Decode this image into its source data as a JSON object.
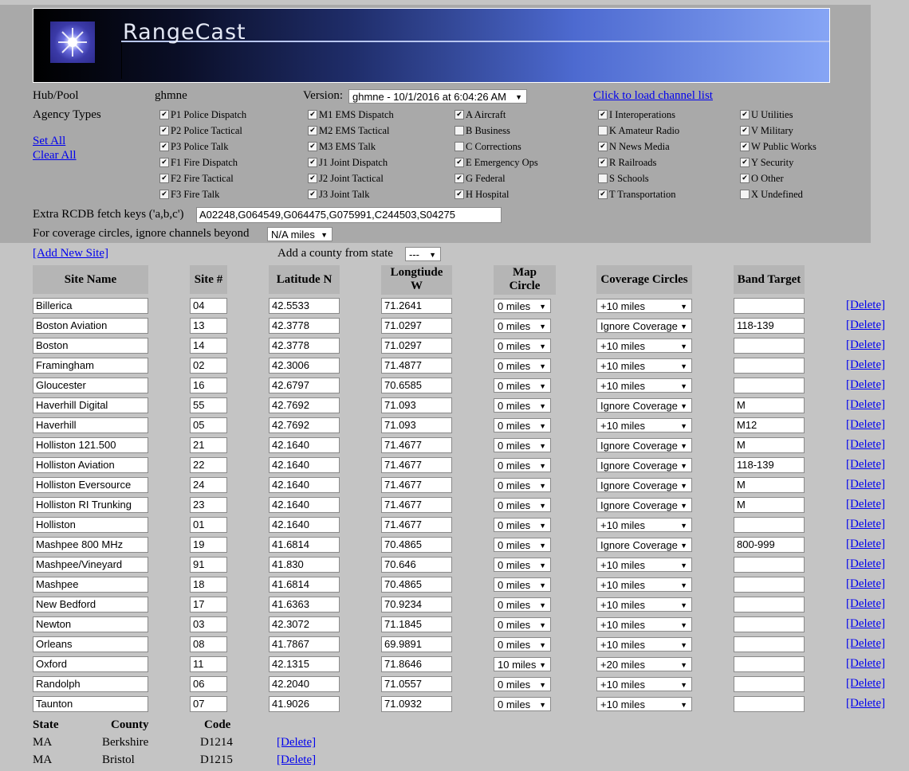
{
  "banner": {
    "title": "RangeCast"
  },
  "hub": {
    "label": "Hub/Pool",
    "value": "ghmne"
  },
  "version": {
    "label": "Version:",
    "value": "ghmne - 10/1/2016 at 6:04:26 AM"
  },
  "load_channels": "Click to load channel list",
  "agency": {
    "label": "Agency Types",
    "set_all": "Set All",
    "clear_all": "Clear All",
    "columns": [
      [
        {
          "label": "P1 Police Dispatch",
          "checked": true
        },
        {
          "label": "P2 Police Tactical",
          "checked": true
        },
        {
          "label": "P3 Police Talk",
          "checked": true
        },
        {
          "label": "F1 Fire Dispatch",
          "checked": true
        },
        {
          "label": "F2 Fire Tactical",
          "checked": true
        },
        {
          "label": "F3 Fire Talk",
          "checked": true
        }
      ],
      [
        {
          "label": "M1 EMS Dispatch",
          "checked": true
        },
        {
          "label": "M2 EMS Tactical",
          "checked": true
        },
        {
          "label": "M3 EMS Talk",
          "checked": true
        },
        {
          "label": "J1 Joint Dispatch",
          "checked": true
        },
        {
          "label": "J2 Joint Tactical",
          "checked": true
        },
        {
          "label": "J3 Joint Talk",
          "checked": true
        }
      ],
      [
        {
          "label": "A Aircraft",
          "checked": true
        },
        {
          "label": "B Business",
          "checked": false
        },
        {
          "label": "C Corrections",
          "checked": false
        },
        {
          "label": "E Emergency Ops",
          "checked": true
        },
        {
          "label": "G Federal",
          "checked": true
        },
        {
          "label": "H Hospital",
          "checked": true
        }
      ],
      [
        {
          "label": "I Interoperations",
          "checked": true
        },
        {
          "label": "K Amateur Radio",
          "checked": false
        },
        {
          "label": "N News Media",
          "checked": true
        },
        {
          "label": "R Railroads",
          "checked": true
        },
        {
          "label": "S Schools",
          "checked": false
        },
        {
          "label": "T Transportation",
          "checked": true
        }
      ],
      [
        {
          "label": "U Utilities",
          "checked": true
        },
        {
          "label": "V Military",
          "checked": true
        },
        {
          "label": "W Public Works",
          "checked": true
        },
        {
          "label": "Y Security",
          "checked": true
        },
        {
          "label": "O Other",
          "checked": true
        },
        {
          "label": "X Undefined",
          "checked": false
        }
      ]
    ]
  },
  "extra_keys": {
    "label": "Extra RCDB fetch keys ('a,b,c')",
    "value": "A02248,G064549,G064475,G075991,C244503,S04275"
  },
  "coverage_ignore": {
    "label": "For coverage circles, ignore channels beyond",
    "value": "N/A miles"
  },
  "add_site": "[Add New Site]",
  "add_county": {
    "label": "Add a county from state",
    "value": "---"
  },
  "table": {
    "headers": {
      "name": "Site Name",
      "num": "Site #",
      "lat": "Latitude N",
      "lon1": "Longtiude",
      "lon2": "W",
      "map1": "Map",
      "map2": "Circle",
      "cov": "Coverage Circles",
      "band": "Band Target"
    },
    "delete_label": "[Delete]",
    "rows": [
      {
        "name": "Billerica",
        "num": "04",
        "lat": "42.5533",
        "lon": "71.2641",
        "map": "0 miles",
        "cov": "+10 miles",
        "band": ""
      },
      {
        "name": "Boston Aviation",
        "num": "13",
        "lat": "42.3778",
        "lon": "71.0297",
        "map": "0 miles",
        "cov": "Ignore Coverage",
        "band": "118-139"
      },
      {
        "name": "Boston",
        "num": "14",
        "lat": "42.3778",
        "lon": "71.0297",
        "map": "0 miles",
        "cov": "+10 miles",
        "band": ""
      },
      {
        "name": "Framingham",
        "num": "02",
        "lat": "42.3006",
        "lon": "71.4877",
        "map": "0 miles",
        "cov": "+10 miles",
        "band": ""
      },
      {
        "name": "Gloucester",
        "num": "16",
        "lat": "42.6797",
        "lon": "70.6585",
        "map": "0 miles",
        "cov": "+10 miles",
        "band": ""
      },
      {
        "name": "Haverhill Digital",
        "num": "55",
        "lat": "42.7692",
        "lon": "71.093",
        "map": "0 miles",
        "cov": "Ignore Coverage",
        "band": "M"
      },
      {
        "name": "Haverhill",
        "num": "05",
        "lat": "42.7692",
        "lon": "71.093",
        "map": "0 miles",
        "cov": "+10 miles",
        "band": "M12"
      },
      {
        "name": "Holliston 121.500",
        "num": "21",
        "lat": "42.1640",
        "lon": "71.4677",
        "map": "0 miles",
        "cov": "Ignore Coverage",
        "band": "M"
      },
      {
        "name": "Holliston Aviation",
        "num": "22",
        "lat": "42.1640",
        "lon": "71.4677",
        "map": "0 miles",
        "cov": "Ignore Coverage",
        "band": "118-139"
      },
      {
        "name": "Holliston Eversource",
        "num": "24",
        "lat": "42.1640",
        "lon": "71.4677",
        "map": "0 miles",
        "cov": "Ignore Coverage",
        "band": "M"
      },
      {
        "name": "Holliston RI Trunking",
        "num": "23",
        "lat": "42.1640",
        "lon": "71.4677",
        "map": "0 miles",
        "cov": "Ignore Coverage",
        "band": "M"
      },
      {
        "name": "Holliston",
        "num": "01",
        "lat": "42.1640",
        "lon": "71.4677",
        "map": "0 miles",
        "cov": "+10 miles",
        "band": ""
      },
      {
        "name": "Mashpee 800 MHz",
        "num": "19",
        "lat": "41.6814",
        "lon": "70.4865",
        "map": "0 miles",
        "cov": "Ignore Coverage",
        "band": "800-999"
      },
      {
        "name": "Mashpee/Vineyard",
        "num": "91",
        "lat": "41.830",
        "lon": "70.646",
        "map": "0 miles",
        "cov": "+10 miles",
        "band": ""
      },
      {
        "name": "Mashpee",
        "num": "18",
        "lat": "41.6814",
        "lon": "70.4865",
        "map": "0 miles",
        "cov": "+10 miles",
        "band": ""
      },
      {
        "name": "New Bedford",
        "num": "17",
        "lat": "41.6363",
        "lon": "70.9234",
        "map": "0 miles",
        "cov": "+10 miles",
        "band": ""
      },
      {
        "name": "Newton",
        "num": "03",
        "lat": "42.3072",
        "lon": "71.1845",
        "map": "0 miles",
        "cov": "+10 miles",
        "band": ""
      },
      {
        "name": "Orleans",
        "num": "08",
        "lat": "41.7867",
        "lon": "69.9891",
        "map": "0 miles",
        "cov": "+10 miles",
        "band": ""
      },
      {
        "name": "Oxford",
        "num": "11",
        "lat": "42.1315",
        "lon": "71.8646",
        "map": "10 miles",
        "cov": "+20 miles",
        "band": ""
      },
      {
        "name": "Randolph",
        "num": "06",
        "lat": "42.2040",
        "lon": "71.0557",
        "map": "0 miles",
        "cov": "+10 miles",
        "band": ""
      },
      {
        "name": "Taunton",
        "num": "07",
        "lat": "41.9026",
        "lon": "71.0932",
        "map": "0 miles",
        "cov": "+10 miles",
        "band": ""
      }
    ]
  },
  "counties": {
    "headers": {
      "state": "State",
      "county": "County",
      "code": "Code"
    },
    "delete_label": "[Delete]",
    "rows": [
      {
        "state": "MA",
        "county": "Berkshire",
        "code": "D1214"
      },
      {
        "state": "MA",
        "county": "Bristol",
        "code": "D1215"
      }
    ]
  }
}
